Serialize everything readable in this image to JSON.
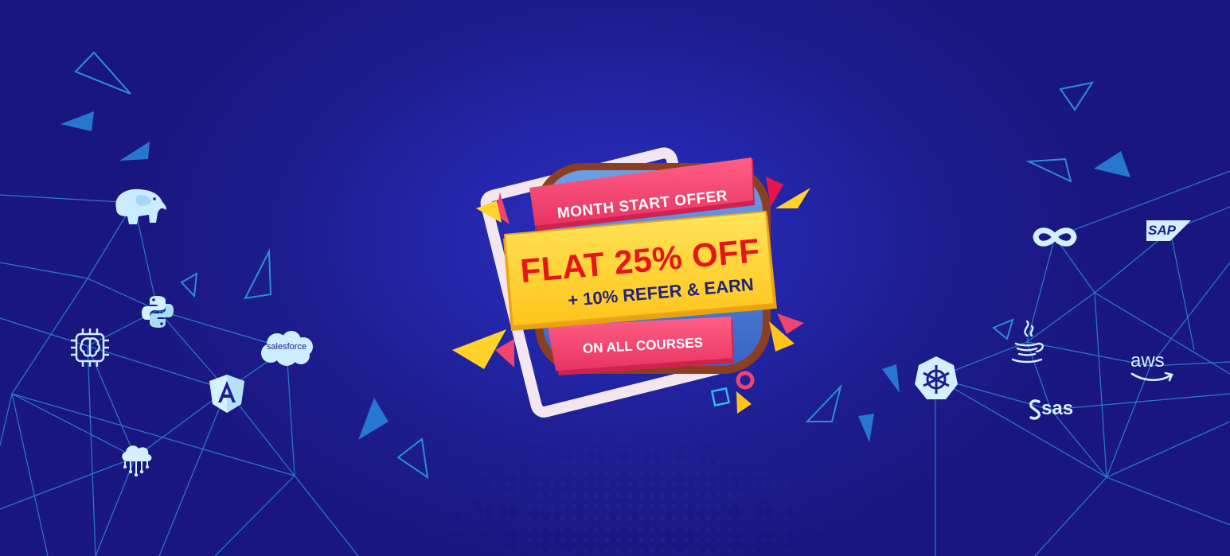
{
  "banner": {
    "offer_title": "MONTH START OFFER",
    "discount": "FLAT 25% OFF",
    "refer": "+ 10% REFER & EARN",
    "scope": "ON ALL COURSES"
  },
  "logos": {
    "salesforce": "salesforce",
    "sap": "SAP",
    "aws": "aws",
    "sas": "sas"
  },
  "colors": {
    "background": "#1e1d8f",
    "ribbon_pink": "#f0436e",
    "ribbon_yellow": "#ffd32a",
    "discount_red": "#e8141c",
    "refer_navy": "#22237a",
    "accent_orange": "#f7a91b",
    "line_cyan": "#2fa0d8"
  },
  "icons": [
    "hadoop-elephant-icon",
    "python-icon",
    "brain-chip-icon",
    "angular-icon",
    "salesforce-cloud-icon",
    "cloud-network-icon",
    "infinity-devops-icon",
    "sap-icon",
    "java-icon",
    "kubernetes-icon",
    "aws-icon",
    "sas-icon"
  ]
}
